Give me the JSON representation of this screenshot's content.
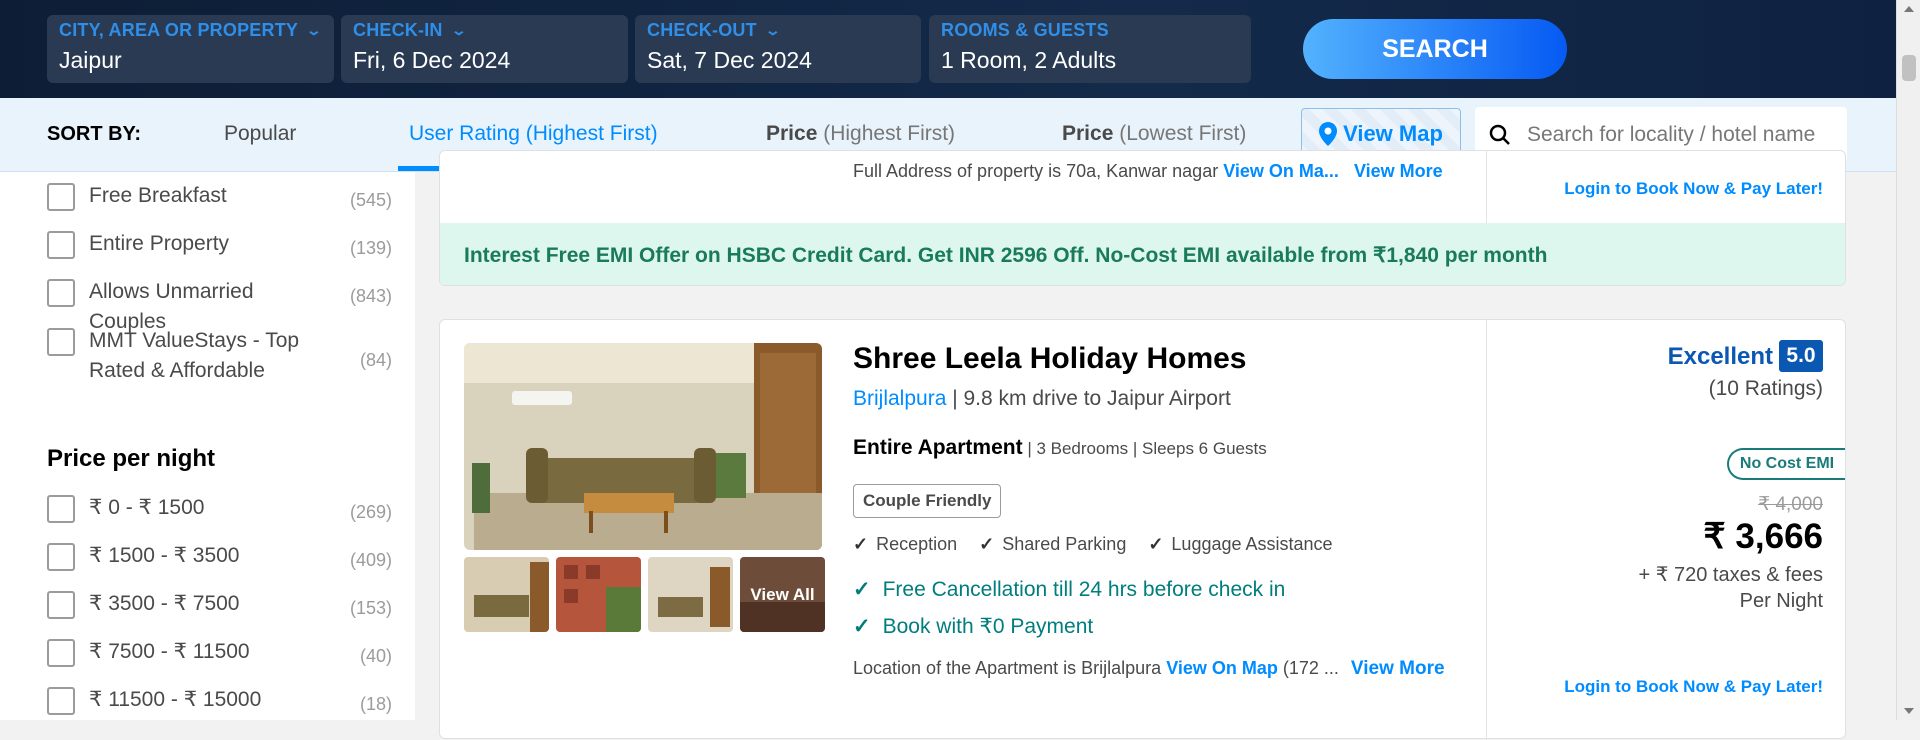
{
  "search": {
    "city_label": "CITY, AREA OR PROPERTY",
    "city_value": "Jaipur",
    "checkin_label": "CHECK-IN",
    "checkin_value": "Fri, 6 Dec 2024",
    "checkout_label": "CHECK-OUT",
    "checkout_value": "Sat, 7 Dec 2024",
    "rooms_label": "ROOMS & GUESTS",
    "rooms_value": "1 Room, 2 Adults",
    "button": "SEARCH"
  },
  "sort": {
    "label": "SORT BY:",
    "options": [
      {
        "main": "Popular",
        "sub": ""
      },
      {
        "main": "User Rating",
        "sub": " (Highest First)"
      },
      {
        "main": "Price",
        "sub": " (Highest First)"
      },
      {
        "main": "Price",
        "sub": " (Lowest First)"
      }
    ],
    "active": "User Rating",
    "view_map": "View Map",
    "search_placeholder": "Search for locality / hotel name"
  },
  "filters": {
    "amenities": [
      {
        "label": "Free Breakfast",
        "count": "(545)"
      },
      {
        "label": "Entire Property",
        "count": "(139)"
      },
      {
        "label": "Allows Unmarried Couples",
        "count": "(843)"
      },
      {
        "label": "MMT ValueStays - Top Rated & Affordable",
        "count": "(84)"
      }
    ],
    "price_title": "Price per night",
    "price_ranges": [
      {
        "label": "₹ 0 - ₹ 1500",
        "count": "(269)"
      },
      {
        "label": "₹ 1500 - ₹ 3500",
        "count": "(409)"
      },
      {
        "label": "₹ 3500 - ₹ 7500",
        "count": "(153)"
      },
      {
        "label": "₹ 7500 - ₹ 11500",
        "count": "(40)"
      },
      {
        "label": "₹ 11500 - ₹ 15000",
        "count": "(18)"
      }
    ]
  },
  "card_prev": {
    "address": "Full Address of property is 70a, Kanwar nagar",
    "view_on_map": "View On Ma...",
    "view_more": "View More",
    "login": "Login to Book Now & Pay Later!",
    "emi_offer": "Interest Free EMI Offer on HSBC Credit Card. Get INR 2596 Off. No-Cost EMI available from ₹1,840 per month"
  },
  "hotel": {
    "name": "Shree Leela Holiday Homes",
    "area": "Brijlalpura",
    "distance": " | 9.8 km drive to Jaipur Airport",
    "type": "Entire Apartment",
    "details": " | 3 Bedrooms | Sleeps 6 Guests",
    "tag": "Couple Friendly",
    "amenities": [
      "Reception",
      "Shared Parking",
      "Luggage Assistance"
    ],
    "perks": [
      "Free Cancellation till 24 hrs before check in",
      "Book with ₹0 Payment"
    ],
    "location_text": "Location of the Apartment is Brijlalpura",
    "view_on_map": "View On Map",
    "location_extra": " (172 ...",
    "view_more": "View More",
    "view_all": "View All",
    "rating_text": "Excellent",
    "rating_score": "5.0",
    "ratings_count": "(10 Ratings)",
    "emi_tag": "No Cost EMI",
    "old_price": "₹ 4,000",
    "price": "₹ 3,666",
    "taxes": "+ ₹ 720 taxes & fees",
    "per_night": "Per Night",
    "login": "Login to Book Now & Pay Later!"
  },
  "colors": {
    "accent": "#008cff",
    "rating": "#0b58b2",
    "perk": "#007e7d",
    "emi_banner": "#ddf6ee"
  }
}
